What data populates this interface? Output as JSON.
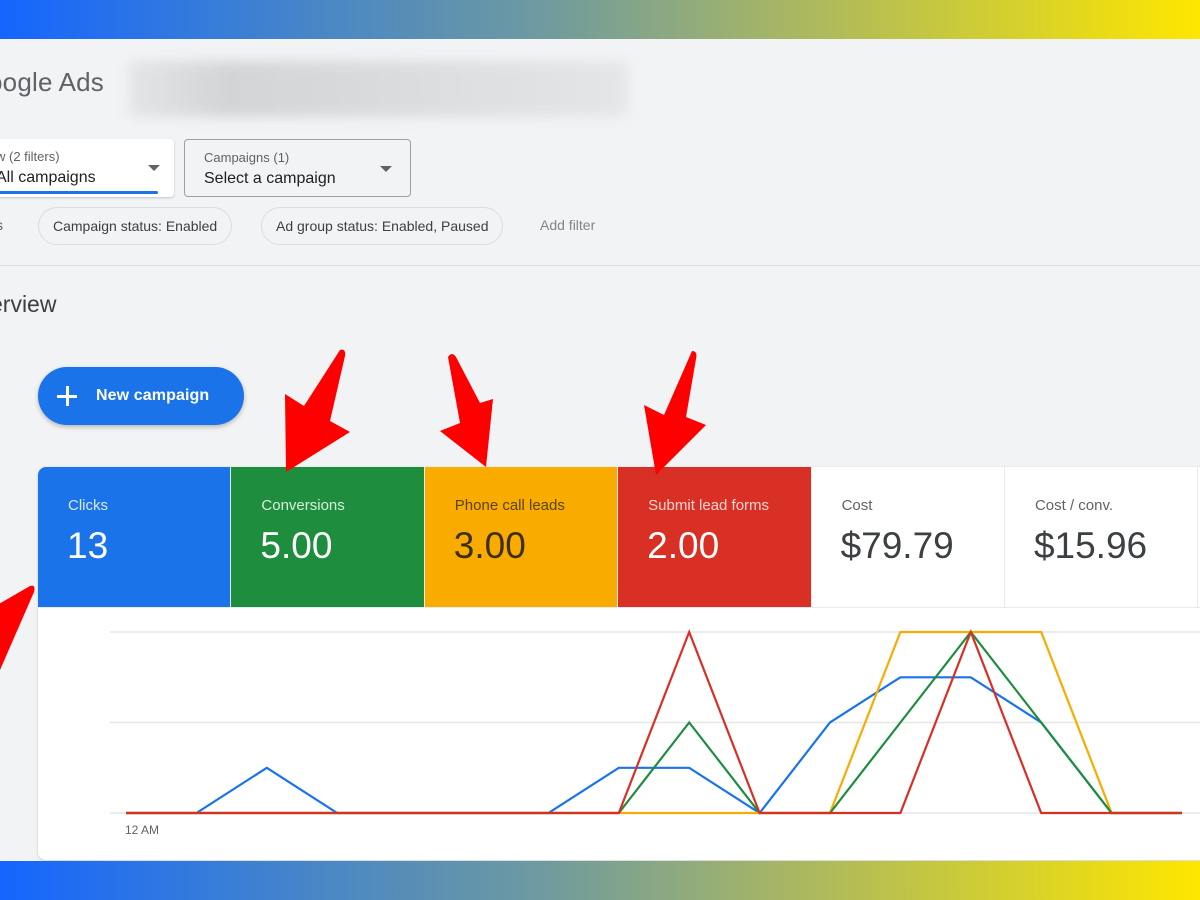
{
  "app": {
    "title": "oogle Ads",
    "account_name_blurred": true
  },
  "filters": {
    "view_dropdown": {
      "label": "w (2 filters)",
      "value": "All campaigns"
    },
    "campaign_dropdown": {
      "label": "Campaigns (1)",
      "value": "Select a campaign"
    },
    "filters_cut_label": "s",
    "chips": [
      {
        "label": "Campaign status: Enabled"
      },
      {
        "label": "Ad group status: Enabled, Paused"
      }
    ],
    "add_filter_label": "Add filter"
  },
  "section": {
    "title": "erview"
  },
  "new_campaign_button": {
    "label": "New campaign"
  },
  "metrics": [
    {
      "label": "Clicks",
      "value": "13",
      "bg": "#1a73e8",
      "label_color": "#dbe8fc",
      "value_color": "#ffffff"
    },
    {
      "label": "Conversions",
      "value": "5.00",
      "bg": "#1e8e3e",
      "label_color": "#d6f0de",
      "value_color": "#ffffff"
    },
    {
      "label": "Phone call leads",
      "value": "3.00",
      "bg": "#f9ab00",
      "label_color": "#5a4300",
      "value_color": "#3c3000"
    },
    {
      "label": "Submit lead forms",
      "value": "2.00",
      "bg": "#d93025",
      "label_color": "#fbd6d3",
      "value_color": "#ffffff"
    },
    {
      "label": "Cost",
      "value": "$79.79",
      "bg": "#ffffff",
      "label_color": "#5f6368",
      "value_color": "#3c4043"
    },
    {
      "label": "Cost / conv.",
      "value": "$15.96",
      "bg": "#ffffff",
      "label_color": "#5f6368",
      "value_color": "#3c4043"
    }
  ],
  "chart_data": {
    "type": "line",
    "title": "",
    "xlabel": "",
    "ylabel": "",
    "x_tick_labels": [
      "12 AM"
    ],
    "x": [
      0,
      1,
      2,
      3,
      4,
      5,
      6,
      7,
      8,
      9,
      10,
      11,
      12,
      13,
      14,
      15
    ],
    "grid": true,
    "gridlines": 3,
    "series": [
      {
        "name": "Clicks",
        "color": "#1a73e8",
        "ymax": 4,
        "values": [
          0,
          0,
          1,
          0,
          0,
          0,
          0,
          1,
          1,
          0,
          2,
          3,
          3,
          2,
          0,
          0
        ]
      },
      {
        "name": "Conversions",
        "color": "#1e8e3e",
        "ymax": 2,
        "values": [
          0,
          0,
          0,
          0,
          0,
          0,
          0,
          0,
          1,
          0,
          0,
          1,
          2,
          1,
          0,
          0
        ]
      },
      {
        "name": "Phone call leads",
        "color": "#f9ab00",
        "ymax": 1,
        "values": [
          0,
          0,
          0,
          0,
          0,
          0,
          0,
          0,
          0,
          0,
          0,
          1,
          1,
          1,
          0,
          0
        ]
      },
      {
        "name": "Submit lead forms",
        "color": "#d93025",
        "ymax": 1,
        "values": [
          0,
          0,
          0,
          0,
          0,
          0,
          0,
          0,
          1,
          0,
          0,
          0,
          1,
          0,
          0,
          0
        ]
      }
    ]
  },
  "annotations": {
    "arrow_color": "#ff0000",
    "arrows": [
      "arrow-to-conversions",
      "arrow-to-phone-call-leads",
      "arrow-to-submit-lead-forms",
      "arrow-to-clicks"
    ]
  }
}
